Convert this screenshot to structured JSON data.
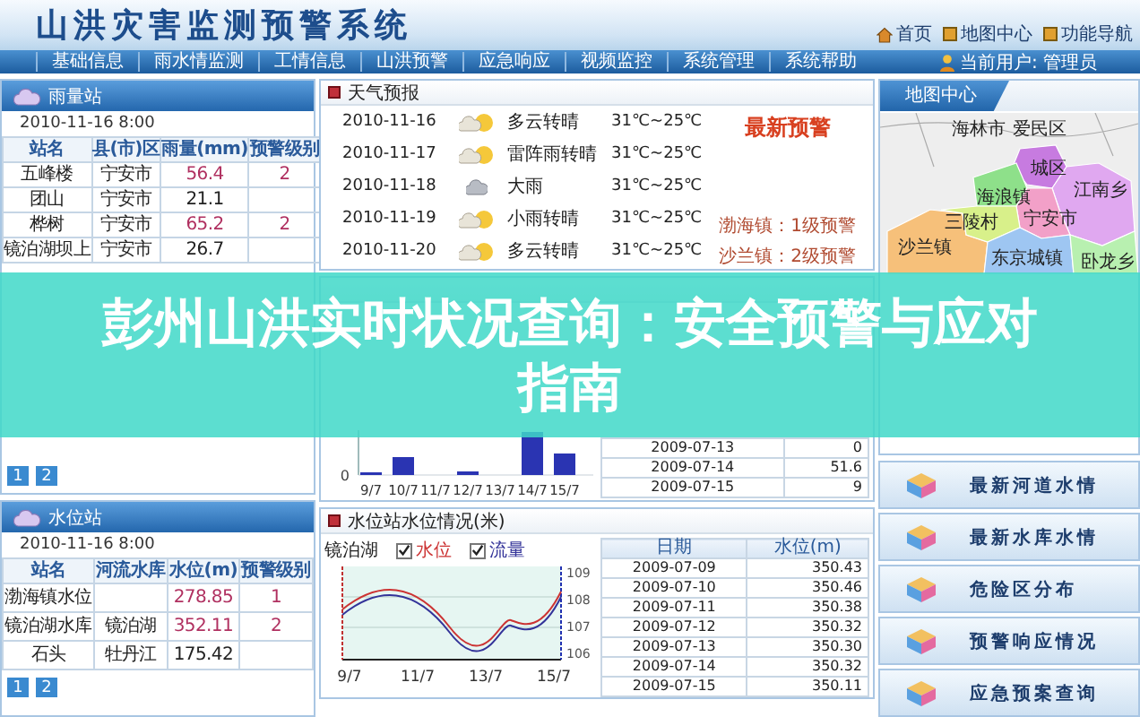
{
  "header": {
    "title": "山洪灾害监测预警系统",
    "links": [
      {
        "label": "首页",
        "kind": "home"
      },
      {
        "label": "地图中心",
        "kind": "page"
      },
      {
        "label": "功能导航",
        "kind": "page"
      }
    ]
  },
  "nav": {
    "items": [
      "基础信息",
      "雨水情监测",
      "工情信息",
      "山洪预警",
      "应急响应",
      "视频监控",
      "系统管理",
      "系统帮助"
    ],
    "user": "当前用户: 管理员"
  },
  "rain_station": {
    "title": "雨量站",
    "time": "2010-11-16 8:00",
    "columns": [
      "站名",
      "县(市)区",
      "雨量(mm)",
      "预警级别"
    ],
    "rows": [
      {
        "station": "五峰楼",
        "county": "宁安市",
        "rainfall": "56.4",
        "level": "2"
      },
      {
        "station": "团山",
        "county": "宁安市",
        "rainfall": "21.1"
      },
      {
        "station": "桦树",
        "county": "宁安市",
        "rainfall": "65.2",
        "level": "2"
      },
      {
        "station": "镜泊湖坝上",
        "county": "宁安市",
        "rainfall": "26.7"
      }
    ],
    "pages": [
      "1",
      "2"
    ]
  },
  "water_station": {
    "title": "水位站",
    "time": "2010-11-16 8:00",
    "columns": [
      "站名",
      "河流水库",
      "水位(m)",
      "预警级别"
    ],
    "rows": [
      {
        "station": "渤海镇水位",
        "level_m": "278.85",
        "level": "1"
      },
      {
        "station": "镜泊湖水库",
        "river": "镜泊湖",
        "level_m": "352.11",
        "level": "2"
      },
      {
        "station": "石头",
        "river": "牡丹江",
        "level_m": "175.42"
      }
    ],
    "pages": [
      "1",
      "2"
    ]
  },
  "weather": {
    "title": "天气预报",
    "days": [
      {
        "date": "2010-11-16",
        "kind": "cloud_sun",
        "desc": "多云转晴",
        "temp": "31℃~25℃"
      },
      {
        "date": "2010-11-17",
        "kind": "cloud_sun",
        "desc": "雷阵雨转晴",
        "temp": "31℃~25℃"
      },
      {
        "date": "2010-11-18",
        "kind": "cloud",
        "desc": "大雨",
        "temp": "31℃~25℃"
      },
      {
        "date": "2010-11-19",
        "kind": "cloud_sun",
        "desc": "小雨转晴",
        "temp": "31℃~25℃"
      },
      {
        "date": "2010-11-20",
        "kind": "cloud_sun",
        "desc": "多云转晴",
        "temp": "31℃~25℃"
      }
    ],
    "warnings": {
      "title": "最新预警",
      "items": [
        "渤海镇：1级预警",
        "沙兰镇：2级预警"
      ]
    }
  },
  "rainfall": {
    "y_labels": [
      "0"
    ],
    "x_labels": [
      "9/7",
      "10/7",
      "11/7",
      "12/7",
      "13/7",
      "14/7",
      "15/7"
    ],
    "rows": [
      [
        "2009-07-13",
        "0"
      ],
      [
        "2009-07-14",
        "51.6"
      ],
      [
        "2009-07-15",
        "9"
      ]
    ]
  },
  "water_level": {
    "title": "水位站水位情况(米)",
    "reservoir": "镜泊湖",
    "toggles": [
      {
        "label": "水位",
        "checked": true,
        "color": "#cc3333"
      },
      {
        "label": "流量",
        "checked": true,
        "color": "#333399"
      }
    ],
    "x_labels": [
      "9/7",
      "11/7",
      "13/7",
      "15/7"
    ],
    "right_ticks": [
      "109",
      "108",
      "107",
      "106"
    ],
    "columns": [
      "日期",
      "水位(m)"
    ],
    "rows": [
      [
        "2009-07-09",
        "350.43"
      ],
      [
        "2009-07-10",
        "350.46"
      ],
      [
        "2009-07-11",
        "350.38"
      ],
      [
        "2009-07-12",
        "350.32"
      ],
      [
        "2009-07-13",
        "350.30"
      ],
      [
        "2009-07-14",
        "350.32"
      ],
      [
        "2009-07-15",
        "350.11"
      ]
    ]
  },
  "map": {
    "title": "地图中心",
    "places": [
      "海林市",
      "爱民区",
      "城区",
      "海浪镇",
      "江南乡",
      "三陵村",
      "宁安市",
      "沙兰镇",
      "东京城镇",
      "卧龙乡"
    ]
  },
  "menu": [
    "最新河道水情",
    "最新水库水情",
    "危险区分布",
    "预警响应情况",
    "应急预案查询"
  ],
  "banner": {
    "title": "彭州山洪实时状况查询：安全预警与应对指南"
  }
}
